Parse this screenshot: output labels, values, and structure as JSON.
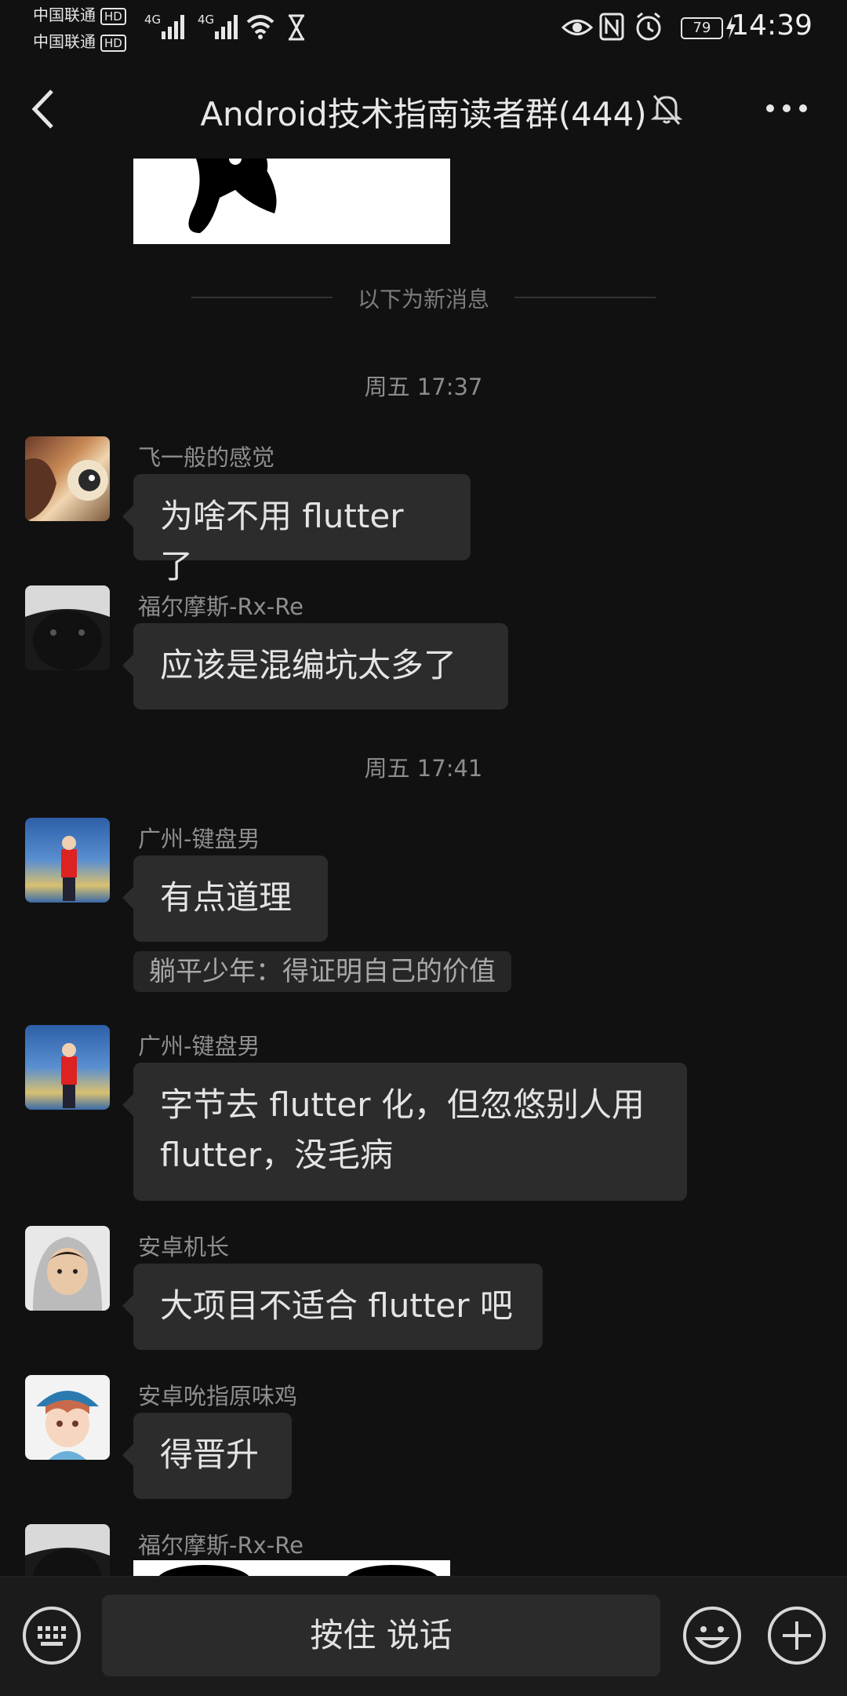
{
  "status_bar": {
    "carrier_1": "中国联通",
    "carrier_2": "中国联通",
    "hd_badge": "HD",
    "network": "4G",
    "battery": "79",
    "time": "14:39"
  },
  "header": {
    "title": "Android技术指南读者群(444)"
  },
  "chat": {
    "new_messages_divider": "以下为新消息",
    "time_1": "周五 17:37",
    "time_2": "周五 17:41",
    "messages": [
      {
        "sender": "飞一般的感觉",
        "text": "为啥不用 flutter 了"
      },
      {
        "sender": "福尔摩斯-Rx-Re",
        "text": "应该是混编坑太多了"
      },
      {
        "sender": "广州-键盘男",
        "text": "有点道理",
        "quote": "躺平少年：得证明自己的价值"
      },
      {
        "sender": "广州-键盘男",
        "text_line1": "字节去 flutter 化，但忽悠别人用",
        "text_line2": "flutter，没毛病"
      },
      {
        "sender": "安卓机长",
        "text": "大项目不适合 flutter 吧"
      },
      {
        "sender": "安卓吮指原味鸡",
        "text": "得晋升"
      },
      {
        "sender": "福尔摩斯-Rx-Re"
      }
    ]
  },
  "input_bar": {
    "voice_label": "按住 说话"
  },
  "icons": {
    "back": "back-arrow-icon",
    "mute": "bell-off-icon",
    "more": "more-dots-icon",
    "keyboard": "keyboard-icon",
    "emoji": "emoji-icon",
    "plus": "plus-icon"
  }
}
